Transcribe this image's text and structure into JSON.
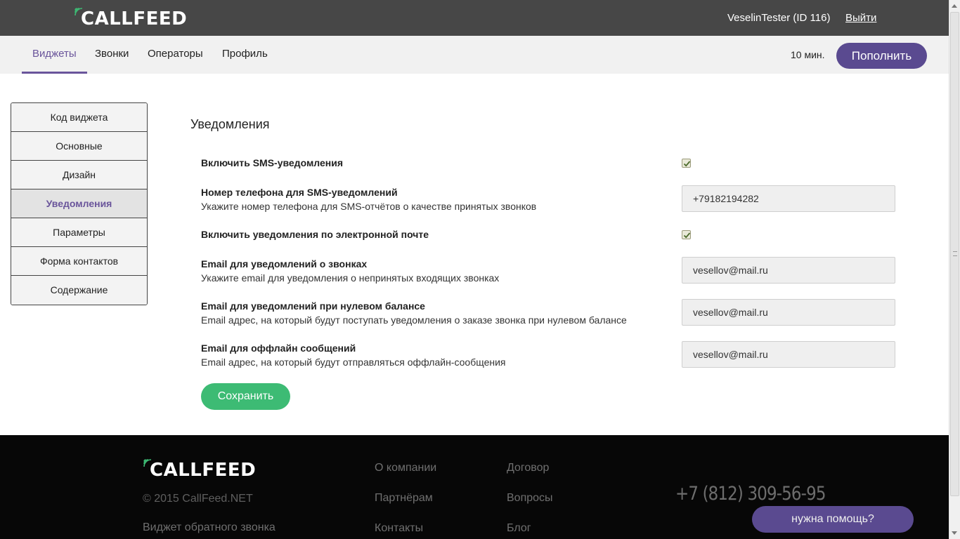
{
  "header": {
    "logo_text": "CALLFEED",
    "user": "VeselinTester (ID 116)",
    "logout": "Выйти"
  },
  "nav": {
    "items": [
      {
        "label": "Виджеты"
      },
      {
        "label": "Звонки"
      },
      {
        "label": "Операторы"
      },
      {
        "label": "Профиль"
      }
    ],
    "active": "Виджеты",
    "minutes": "10 мин.",
    "topup": "Пополнить"
  },
  "sidebar": {
    "items": [
      {
        "label": "Код виджета"
      },
      {
        "label": "Основные"
      },
      {
        "label": "Дизайн"
      },
      {
        "label": "Уведомления"
      },
      {
        "label": "Параметры"
      },
      {
        "label": "Форма контактов"
      },
      {
        "label": "Содержание"
      }
    ],
    "active": "Уведомления"
  },
  "main": {
    "title": "Уведомления",
    "sms_enable": {
      "label": "Включить SMS-уведомления",
      "checked": true
    },
    "sms_phone": {
      "label": "Номер телефона для SMS-уведомлений",
      "help": "Укажите номер телефона для SMS-отчётов о качестве принятых звонков",
      "value": "+79182194282"
    },
    "email_enable": {
      "label": "Включить уведомления по электронной почте",
      "checked": true
    },
    "email_calls": {
      "label": "Email для уведомлений о звонках",
      "help": "Укажите email для уведомления о непринятых входящих звонках",
      "value": "vesellov@mail.ru"
    },
    "email_zero_balance": {
      "label": "Email для уведомлений при нулевом балансе",
      "help": "Email адрес, на который будут поступать уведомления о заказе звонка при нулевом балансе",
      "value": "vesellov@mail.ru"
    },
    "email_offline": {
      "label": "Email для оффлайн сообщений",
      "help": "Email адрес, на который будут отправляться оффлайн-сообщения",
      "value": "vesellov@mail.ru"
    },
    "save": "Сохранить"
  },
  "footer": {
    "logo_text": "CALLFEED",
    "copyright": "© 2015 CallFeed.NET",
    "widget_link": "Виджет обратного звонка",
    "col1": [
      "О компании",
      "Партнёрам",
      "Контакты"
    ],
    "col2": [
      "Договор",
      "Вопросы",
      "Блог"
    ],
    "phone": "+7 (812) 309-56-95"
  },
  "help_button": "нужна помощь?",
  "colors": {
    "accent": "#6a559b",
    "button_purple": "#5a4a90",
    "save_green": "#3dbb74",
    "topbar": "#474747",
    "footer": "#070707",
    "logo_wave": "#3dbb74"
  }
}
